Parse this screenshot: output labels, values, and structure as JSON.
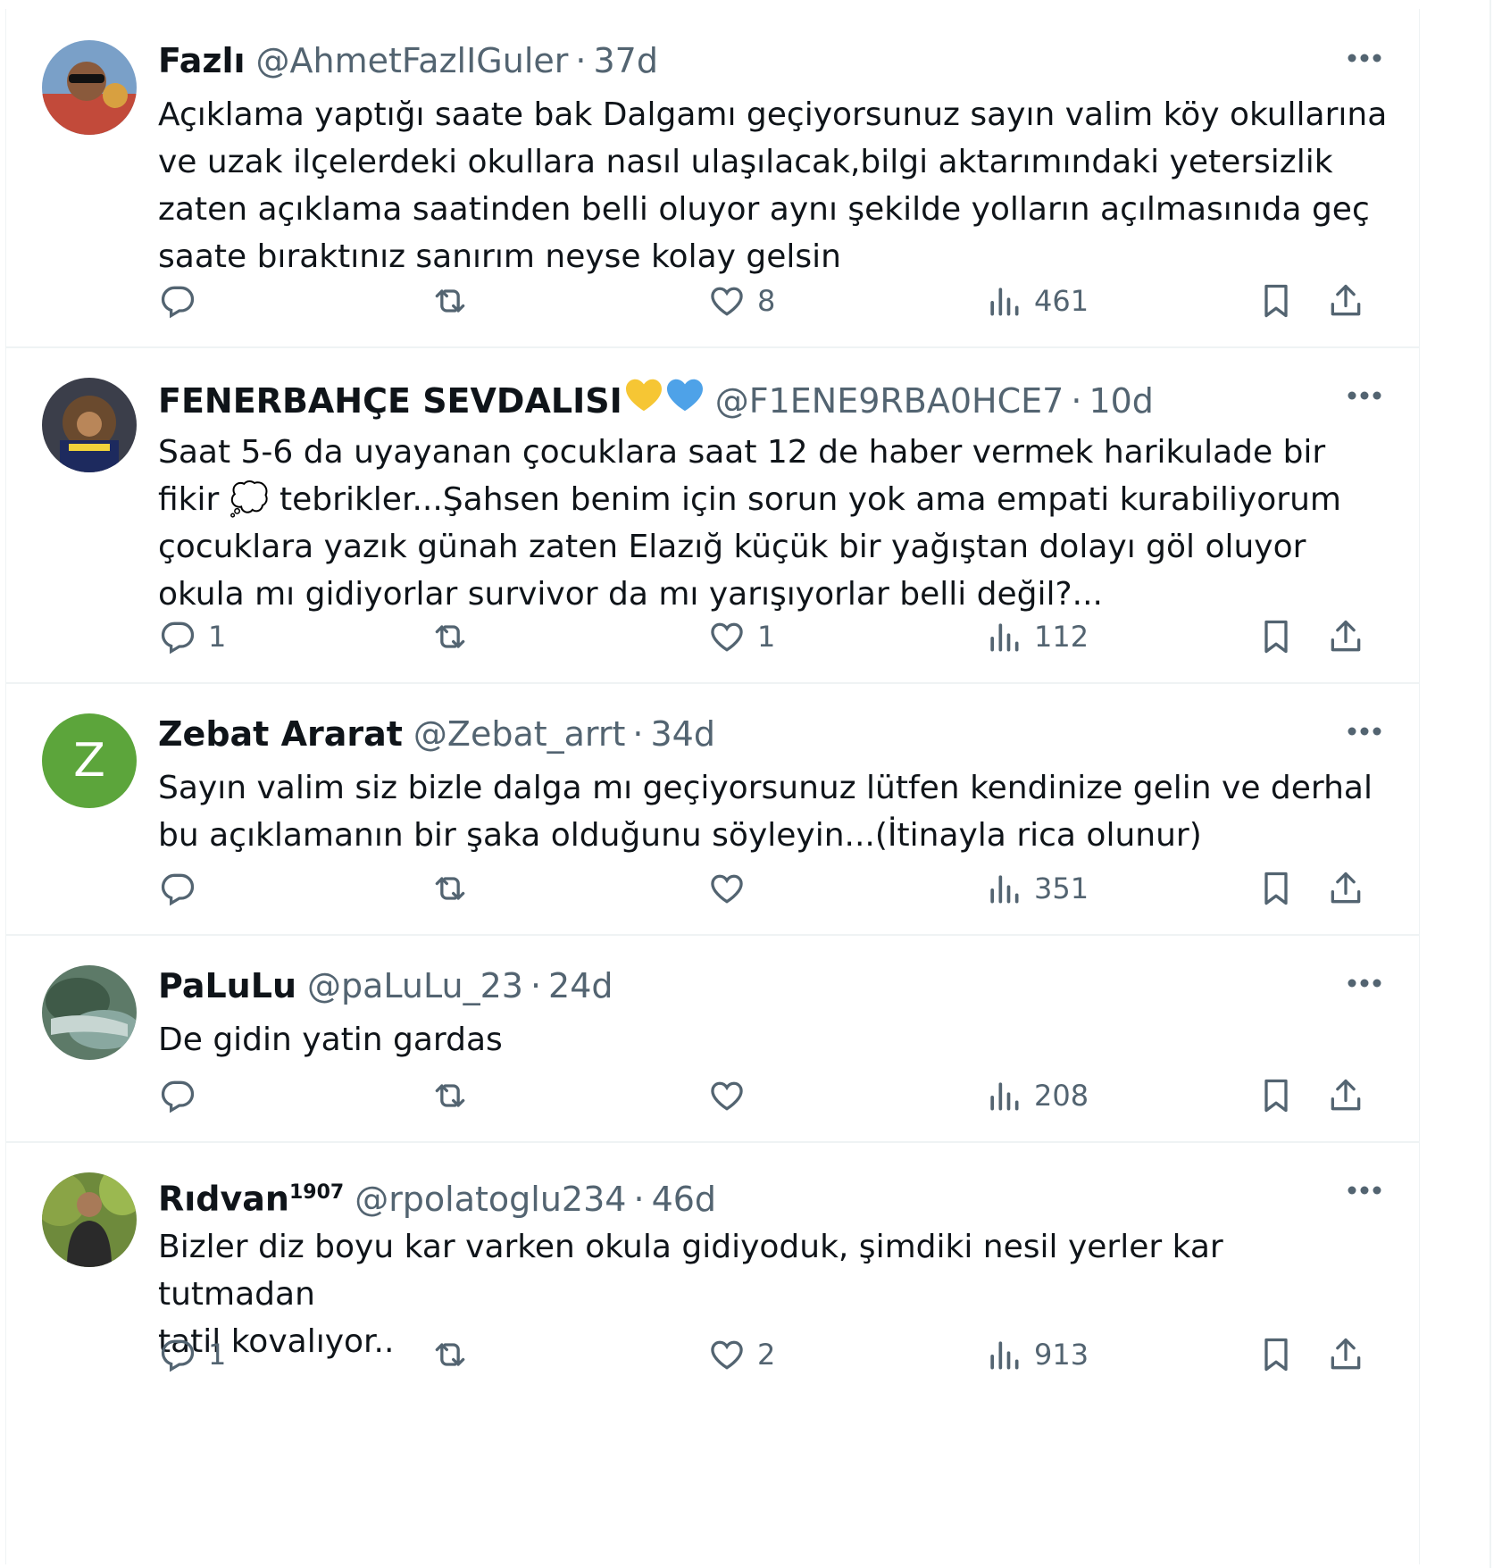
{
  "tweets": [
    {
      "name": "Fazlı",
      "name_suffix": "",
      "emojis": [],
      "handle": "@AhmetFazlIGuler",
      "separator": "·",
      "time": "37d",
      "text": "Açıklama yaptığı saate bak Dalgamı geçiyorsunuz sayın valim köy okullarına\nve uzak ilçelerdeki okullara nasıl ulaşılacak,bilgi aktarımındaki yetersizlik\nzaten açıklama saatinden belli oluyor aynı şekilde yolların açılmasınıda geç\nsaate bıraktınız sanırım neyse kolay gelsin",
      "replies": "",
      "retweets": "",
      "likes": "8",
      "views": "461"
    },
    {
      "name": "FENERBAHÇE SEVDALISI",
      "name_suffix": "",
      "emojis": [
        "yellow-heart",
        "blue-heart"
      ],
      "handle": "@F1ENE9RBA0HCE7",
      "separator": "·",
      "time": "10d",
      "text": "Saat 5-6 da uyayanan çocuklara saat 12 de haber vermek harikulade bir\nfikir 💭 tebrikler...Şahsen benim için sorun yok ama empati kurabiliyorum\nçocuklara yazık günah zaten Elazığ küçük bir yağıştan dolayı göl oluyor\nokula mı gidiyorlar survivor da mı yarışıyorlar belli değil?...",
      "replies": "1",
      "retweets": "",
      "likes": "1",
      "views": "112"
    },
    {
      "name": "Zebat Ararat",
      "name_suffix": "",
      "emojis": [],
      "handle": "@Zebat_arrt",
      "separator": "·",
      "time": "34d",
      "avatar_letter": "Z",
      "text": "Sayın valim siz bizle dalga mı geçiyorsunuz lütfen kendinize gelin ve derhal\nbu açıklamanın bir şaka olduğunu söyleyin...(İtinayla rica olunur)",
      "replies": "",
      "retweets": "",
      "likes": "",
      "views": "351"
    },
    {
      "name": "PaLuLu",
      "name_suffix": "",
      "emojis": [],
      "handle": "@paLuLu_23",
      "separator": "·",
      "time": "24d",
      "text": "De gidin yatin gardas",
      "replies": "",
      "retweets": "",
      "likes": "",
      "views": "208"
    },
    {
      "name": "Rıdvan",
      "name_suffix": "1907",
      "emojis": [],
      "handle": "@rpolatoglu234",
      "separator": "·",
      "time": "46d",
      "text": "Bizler diz boyu kar varken okula gidiyoduk, şimdiki nesil yerler kar tutmadan\ntatil kovalıyor..",
      "replies": "1",
      "retweets": "",
      "likes": "2",
      "views": "913"
    }
  ],
  "icons": {
    "avatar": "avatar",
    "more": "more-horizontal-icon",
    "reply": "reply-icon",
    "retweet": "retweet-icon",
    "like": "heart-icon",
    "views": "views-chart-icon",
    "bookmark": "bookmark-icon",
    "share": "share-upload-icon"
  },
  "colors": {
    "text": "#0f1419",
    "secondary": "#536471",
    "divider": "#eff3f4",
    "avatar_letter_bg": "#5ca53b",
    "yellow_heart": "#f6c634",
    "blue_heart": "#4ea2e8"
  }
}
